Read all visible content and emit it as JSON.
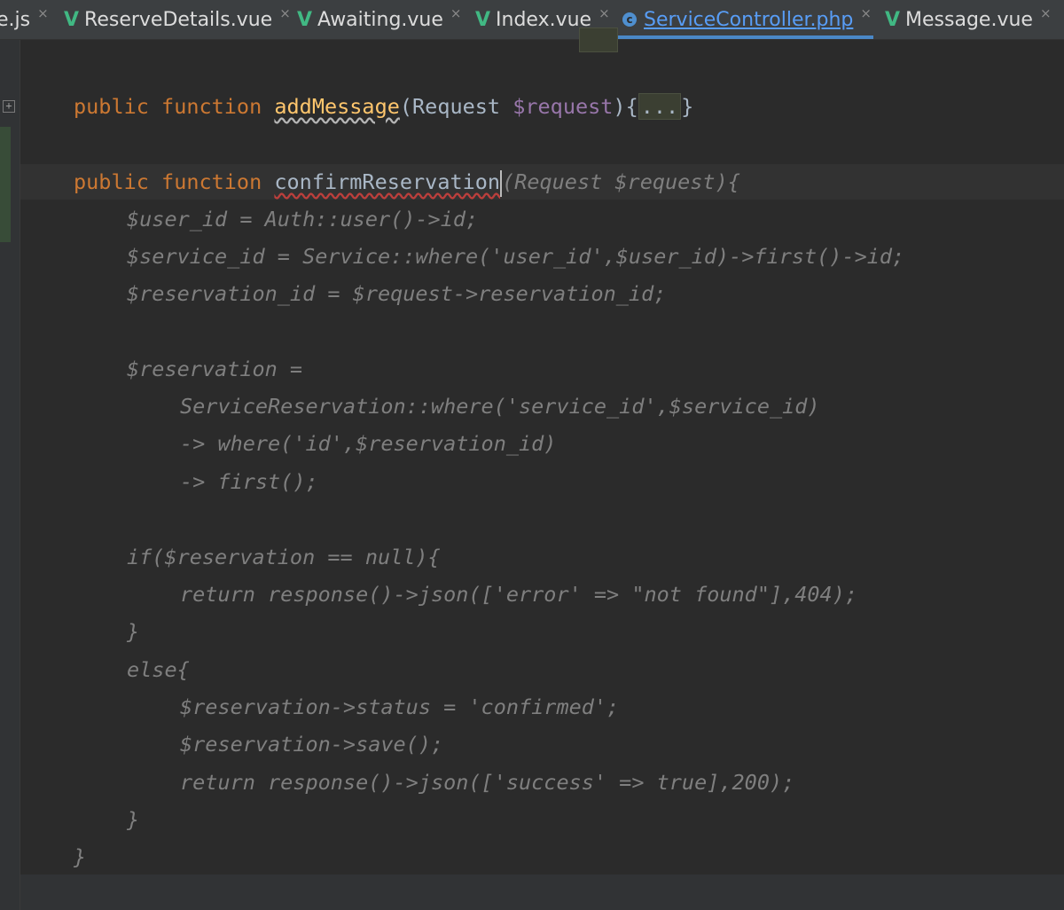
{
  "tabs": [
    {
      "label": "e.js",
      "icon": "none",
      "active": false
    },
    {
      "label": "ReserveDetails.vue",
      "icon": "vue-icon",
      "active": false
    },
    {
      "label": "Awaiting.vue",
      "icon": "vue-icon",
      "active": false
    },
    {
      "label": "Index.vue",
      "icon": "vue-icon",
      "active": false
    },
    {
      "label": "ServiceController.php",
      "icon": "php-icon",
      "active": true
    },
    {
      "label": "Message.vue",
      "icon": "vue-icon",
      "active": false
    }
  ],
  "tab_close_glyph": "×",
  "vue_glyph": "V",
  "php_glyph": "c",
  "code": {
    "l1": {
      "public": "public",
      "function": "function",
      "name": "addMessage",
      "open": "(",
      "type": "Request",
      "var": "$request",
      "close": "){",
      "folded": "...",
      "end": "}"
    },
    "l2": {
      "public": "public",
      "function": "function",
      "name": "confirmReservation",
      "params": "(Request $request){"
    },
    "l3": "$user_id = Auth::user()->id;",
    "l4": "$service_id = Service::where('user_id',$user_id)->first()->id;",
    "l5": "$reservation_id = $request->reservation_id;",
    "l6": "$reservation =",
    "l7": "ServiceReservation::where('service_id',$service_id)",
    "l8": "-> where('id',$reservation_id)",
    "l9": "-> first();",
    "l10": "if($reservation == null){",
    "l11": "return response()->json(['error' => \"not found\"],404);",
    "l12": "}",
    "l13": "else{",
    "l14": "$reservation->status = 'confirmed';",
    "l15": "$reservation->save();",
    "l16": "return response()->json(['success' => true],200);",
    "l17": "}",
    "l18": "}"
  },
  "colors": {
    "keyword": "#cc7832",
    "function_name": "#ffc66d",
    "variable": "#9876aa",
    "dim_code": "#7f7f7f",
    "vue_green": "#41b883",
    "active_tab": "#589df6"
  }
}
